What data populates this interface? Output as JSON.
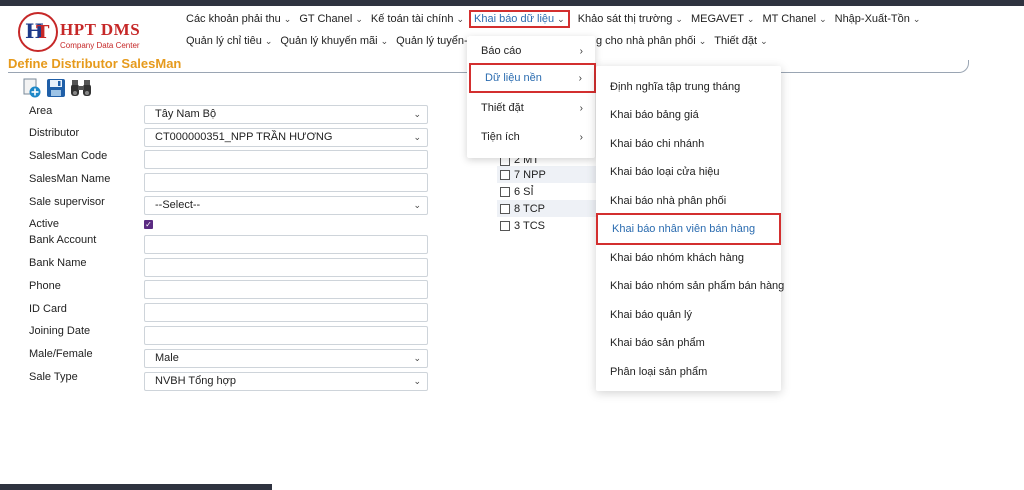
{
  "logo": {
    "title": "HPT DMS",
    "subtitle": "Company Data Center"
  },
  "page_title": "Define Distributor SalesMan",
  "menu": {
    "row1": [
      {
        "label": "Các khoản phải thu",
        "has_chevron": true
      },
      {
        "label": "GT Chanel",
        "has_chevron": true
      },
      {
        "label": "Kế toán tài chính",
        "has_chevron": true
      },
      {
        "label": "Khai báo dữ liệu",
        "has_chevron": true,
        "active": true
      },
      {
        "label": "Khảo sát thị trường",
        "has_chevron": true
      },
      {
        "label": "MEGAVET",
        "has_chevron": true
      },
      {
        "label": "MT Chanel",
        "has_chevron": true
      },
      {
        "label": "Nhập-Xuất-Tồn",
        "has_chevron": true
      }
    ],
    "row2": [
      {
        "label": "Quản lý chỉ tiêu",
        "has_chevron": true
      },
      {
        "label": "Quản lý khuyến mãi",
        "has_chevron": true
      },
      {
        "label": "Quản lý tuyển-khảo",
        "has_chevron": false
      }
    ],
    "row2_tail": [
      {
        "label": "g cho nhà phân phối",
        "has_chevron": true
      },
      {
        "label": "Thiết đặt",
        "has_chevron": true
      }
    ]
  },
  "toolbar": {
    "icons": [
      "add-icon",
      "save-icon",
      "search-icon"
    ]
  },
  "form": {
    "fields": [
      {
        "label": "Area",
        "type": "select",
        "value": "Tây Nam Bộ"
      },
      {
        "label": "Distributor",
        "type": "select",
        "value": "CT000000351_NPP TRẦN HƯƠNG"
      },
      {
        "label": "SalesMan Code",
        "type": "text",
        "value": ""
      },
      {
        "label": "SalesMan Name",
        "type": "text",
        "value": ""
      },
      {
        "label": "Sale supervisor",
        "type": "select",
        "value": "--Select--"
      },
      {
        "label": "Active",
        "type": "checkbox",
        "checked": true
      },
      {
        "label": "Bank Account",
        "type": "text",
        "value": ""
      },
      {
        "label": "Bank Name",
        "type": "text",
        "value": ""
      },
      {
        "label": "Phone",
        "type": "text",
        "value": ""
      },
      {
        "label": "ID Card",
        "type": "text",
        "value": ""
      },
      {
        "label": "Joining Date",
        "type": "text",
        "value": ""
      },
      {
        "label": "Male/Female",
        "type": "select",
        "value": "Male"
      },
      {
        "label": "Sale Type",
        "type": "select",
        "value": "NVBH Tổng hợp"
      }
    ]
  },
  "channel_options": [
    "2 MT",
    "7 NPP",
    "6 SỈ",
    "8 TCP",
    "3 TCS"
  ],
  "dropdown": {
    "items": [
      {
        "label": "Báo cáo",
        "has_arrow": true
      },
      {
        "label": "Dữ liệu nền",
        "has_arrow": true,
        "highlighted": true
      },
      {
        "label": "Thiết đặt",
        "has_arrow": true
      },
      {
        "label": "Tiện ích",
        "has_arrow": true
      }
    ]
  },
  "submenu": {
    "items": [
      {
        "label": "Định nghĩa tập trung tháng"
      },
      {
        "label": "Khai báo bảng giá"
      },
      {
        "label": "Khai báo chi nhánh"
      },
      {
        "label": "Khai báo loại cửa hiệu"
      },
      {
        "label": "Khai báo nhà phân phối"
      },
      {
        "label": "Khai báo nhân viên bán hàng",
        "highlighted": true
      },
      {
        "label": "Khai báo nhóm khách hàng"
      },
      {
        "label": "Khai báo nhóm sản phẩm bán hàng"
      },
      {
        "label": "Khai báo quản lý"
      },
      {
        "label": "Khai báo sản phẩm"
      },
      {
        "label": "Phân loại sản phẩm"
      }
    ]
  },
  "colors": {
    "accent": "#2b6cb0",
    "highlight_border": "#d32f2f",
    "page_title": "#e69a1c",
    "logo": "#c62828",
    "checkbox": "#5b2b82"
  }
}
